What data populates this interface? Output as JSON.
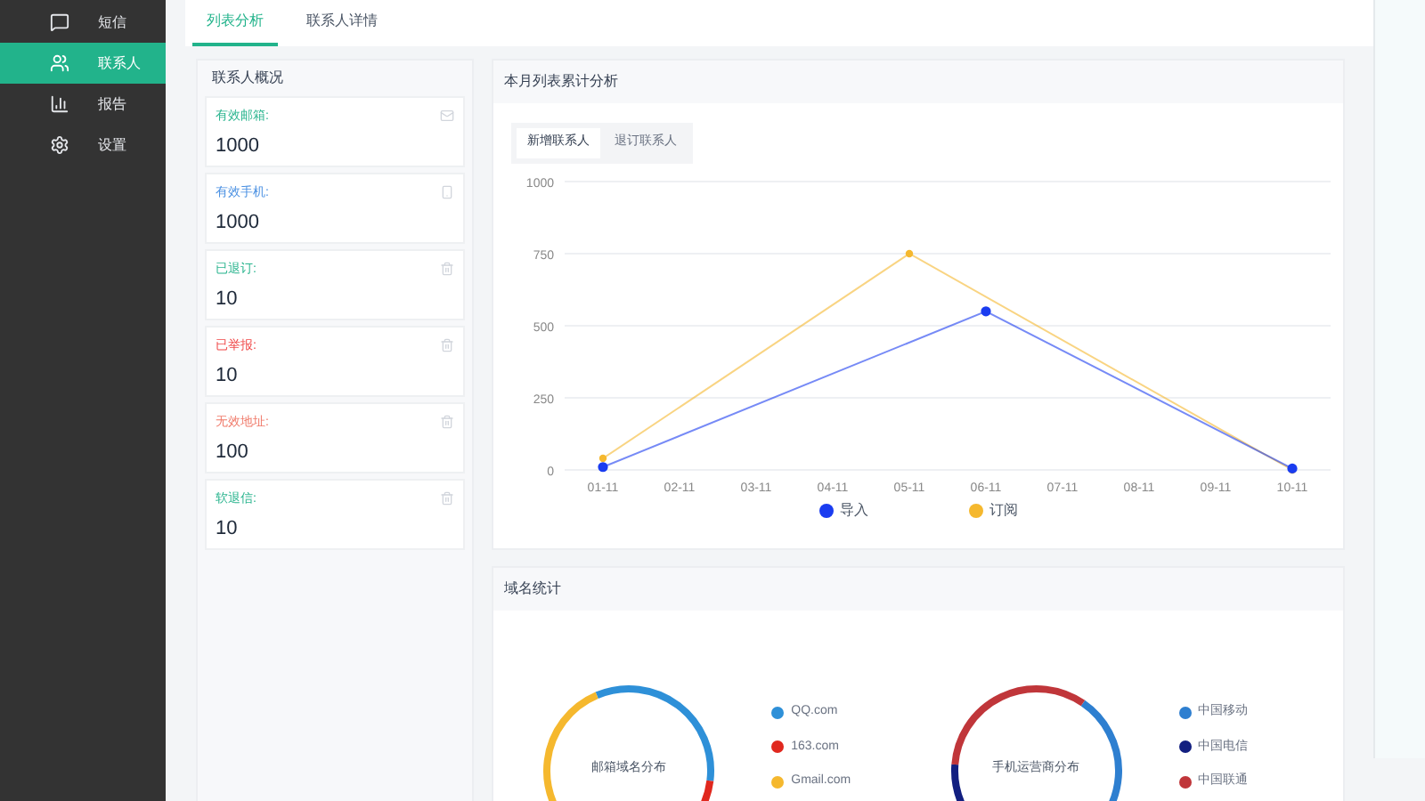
{
  "sidebar": {
    "items": [
      {
        "label": "短信",
        "selected": false
      },
      {
        "label": "联系人",
        "selected": true
      },
      {
        "label": "报告",
        "selected": false
      },
      {
        "label": "设置",
        "selected": false
      }
    ]
  },
  "tabs": [
    {
      "label": "列表分析",
      "selected": true
    },
    {
      "label": "联系人详情",
      "selected": false
    }
  ],
  "overview": {
    "title": "联系人概况",
    "stats": [
      {
        "label": "有效邮箱:",
        "value": "1000",
        "color": "#2bb58f",
        "kind": "mail"
      },
      {
        "label": "有效手机:",
        "value": "1000",
        "color": "#4a90e2",
        "kind": "phone"
      },
      {
        "label": "已退订:",
        "value": "10",
        "color": "#2bb58f",
        "kind": "trash"
      },
      {
        "label": "已举报:",
        "value": "10",
        "color": "#f04848",
        "kind": "trash"
      },
      {
        "label": "无效地址:",
        "value": "100",
        "color": "#f07a6a",
        "kind": "trash"
      },
      {
        "label": "软退信:",
        "value": "10",
        "color": "#2bb58f",
        "kind": "trash"
      }
    ]
  },
  "trend": {
    "title": "本月列表累计分析",
    "toggle": [
      {
        "label": "新增联系人",
        "selected": true
      },
      {
        "label": "退订联系人",
        "selected": false
      }
    ],
    "chart_data": {
      "type": "line",
      "categories": [
        "01-11",
        "02-11",
        "03-11",
        "04-11",
        "05-11",
        "06-11",
        "07-11",
        "08-11",
        "09-11",
        "10-11"
      ],
      "ylim": [
        0,
        1000
      ],
      "yticks": [
        0,
        250,
        500,
        750,
        1000
      ],
      "grid": true,
      "legend": true,
      "series": [
        {
          "name": "导入",
          "color": "#1a3cf0",
          "marker": true,
          "values": [
            10,
            null,
            null,
            null,
            null,
            550,
            null,
            null,
            null,
            5
          ]
        },
        {
          "name": "订阅",
          "color": "#f5b82e",
          "marker": true,
          "values": [
            40,
            null,
            null,
            null,
            750,
            null,
            null,
            null,
            null,
            0
          ]
        }
      ]
    }
  },
  "domains": {
    "title": "域名统计",
    "charts": [
      {
        "title": "邮箱域名分布",
        "legend": [
          {
            "label": "QQ.com",
            "color": "#2e90d8"
          },
          {
            "label": "163.com",
            "color": "#e0281e"
          },
          {
            "label": "Gmail.com",
            "color": "#f5b82e"
          }
        ]
      },
      {
        "title": "手机运营商分布",
        "legend": [
          {
            "label": "中国移动",
            "color": "#2e7fd0"
          },
          {
            "label": "中国电信",
            "color": "#121f80"
          },
          {
            "label": "中国联通",
            "color": "#c0363a"
          }
        ]
      }
    ]
  }
}
